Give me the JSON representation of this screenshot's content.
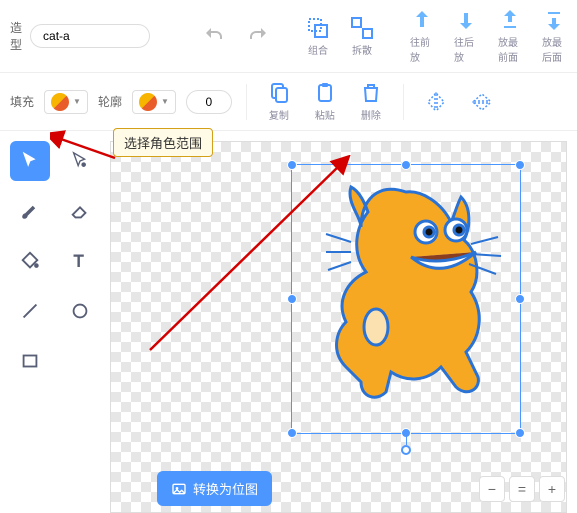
{
  "row1": {
    "costume_label": "造型",
    "costume_value": "cat-a",
    "group": "组合",
    "ungroup": "拆散",
    "forward": "往前放",
    "backward": "往后放",
    "front": "放最前面",
    "back": "放最后面"
  },
  "row2": {
    "fill_label": "填充",
    "outline_label": "轮廓",
    "stroke_width": "0",
    "copy": "复制",
    "paste": "粘贴",
    "delete": "删除"
  },
  "callout": "选择角色范围",
  "convert": "转换为位图",
  "zoom": {
    "out": "−",
    "fit": "=",
    "in": "+"
  }
}
